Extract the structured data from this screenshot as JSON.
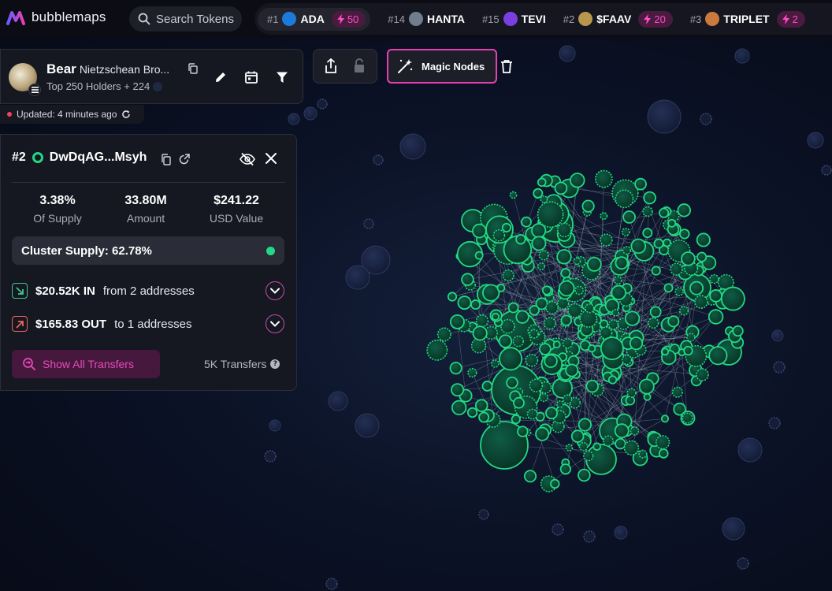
{
  "app": {
    "name": "bubblemaps",
    "search_placeholder": "Search Tokens"
  },
  "ticker": [
    {
      "rank": "#1",
      "symbol": "ADA",
      "boost": "50",
      "color": "#1c7bd8"
    },
    {
      "rank": "#14",
      "symbol": "HANTA",
      "boost": "",
      "color": "#6f7d8c"
    },
    {
      "rank": "#15",
      "symbol": "TEVI",
      "boost": "",
      "color": "#7a3fe0"
    },
    {
      "rank": "#2",
      "symbol": "$FAAV",
      "boost": "20",
      "color": "#b8964d"
    },
    {
      "rank": "#3",
      "symbol": "TRIPLET",
      "boost": "2",
      "color": "#c97a3c"
    }
  ],
  "token": {
    "name": "Bear",
    "full_name": "Nietzschean Bro...",
    "subtitle": "Top 250 Holders + 224",
    "updated": "Updated: 4 minutes ago"
  },
  "toolbar": {
    "magic_nodes": "Magic Nodes"
  },
  "address": {
    "rank": "#2",
    "short": "DwDqAG...Msyh",
    "stats": [
      {
        "value": "3.38%",
        "label": "Of Supply"
      },
      {
        "value": "33.80M",
        "label": "Amount"
      },
      {
        "value": "$241.22",
        "label": "USD Value"
      }
    ],
    "cluster_supply": "Cluster Supply: 62.78%",
    "in_amount": "$20.52K IN",
    "in_text": "from 2 addresses",
    "out_amount": "$165.83 OUT",
    "out_text": "to 1 addresses",
    "show_all": "Show All Transfers",
    "transfers": "5K Transfers"
  },
  "colors": {
    "accent_pink": "#e83fb5",
    "bubble_green": "#22d884",
    "in_green": "#3ec78f",
    "out_red": "#e8665a"
  }
}
